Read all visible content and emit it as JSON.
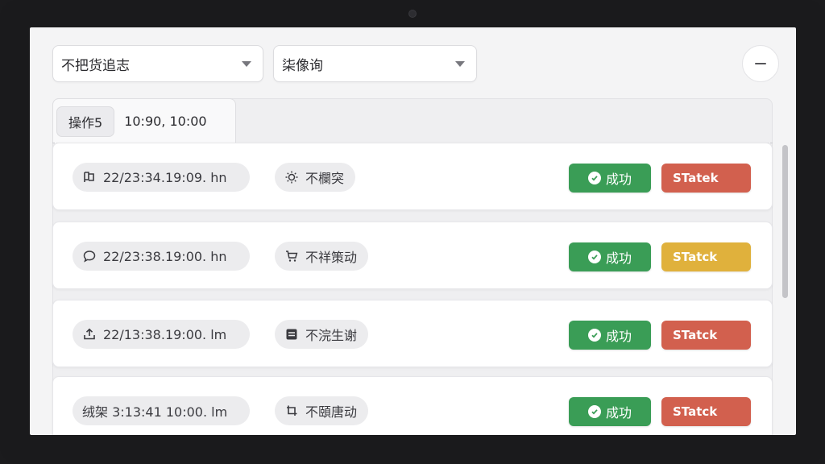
{
  "filters": {
    "left_value": "不把货\u0000追志",
    "right_value": "柒\u0000\u0000像询"
  },
  "tab": {
    "label": "操作5",
    "time": "10:90, 10:00"
  },
  "rows": [
    {
      "timestamp": "22/23:34.19:09. hn",
      "kind": "不欄突",
      "kind_icon": "sun-icon",
      "time_icon": "flag-icon",
      "result": "成功",
      "status": "STatek",
      "status_color": "#d2604e"
    },
    {
      "timestamp": "22/23:38.19:00. hn",
      "kind": "不祥策动",
      "kind_icon": "cart-icon",
      "time_icon": "chat-bubble-icon",
      "result": "成功",
      "status": "STatck",
      "status_color": "#e0b13c"
    },
    {
      "timestamp": "22/13:38.19:00. lm",
      "kind": "不浣生谢",
      "kind_icon": "list-icon",
      "time_icon": "upload-icon",
      "result": "成功",
      "status": "STatck",
      "status_color": "#d2604e"
    },
    {
      "timestamp": "绒架 3:13:41 10:00. lm",
      "kind": "不頤唐动",
      "kind_icon": "crop-icon",
      "time_icon": "",
      "result": "成功",
      "status": "STatck",
      "status_color": "#d2604e"
    }
  ],
  "colors": {
    "success": "#3a9d56",
    "danger": "#d2604e",
    "warning": "#e0b13c"
  }
}
